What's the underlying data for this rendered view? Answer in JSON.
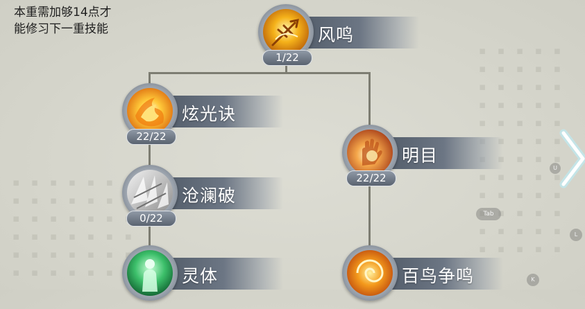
{
  "info": {
    "line1": "本重需加够14点才",
    "line2": "能修习下一重技能"
  },
  "skills": {
    "fengming": {
      "name": "风鸣",
      "count": "1/22",
      "icon": "golden-bird-icon"
    },
    "xuanguang": {
      "name": "炫光诀",
      "count": "22/22",
      "icon": "golden-flame-icon"
    },
    "mingmu": {
      "name": "明目",
      "count": "22/22",
      "icon": "glowing-hand-icon"
    },
    "canglan": {
      "name": "沧澜破",
      "count": "0/22",
      "icon": "crystal-shards-icon"
    },
    "lingti": {
      "name": "灵体",
      "icon": "spirit-body-icon"
    },
    "bainiao": {
      "name": "百鸟争鸣",
      "icon": "phoenix-swirl-icon"
    }
  },
  "hints": {
    "u": "U",
    "tab": "Tab",
    "l": "L",
    "k": "K"
  },
  "colors": {
    "background": "#d6d6cc",
    "label_bar": "#5d6775",
    "connector": "#7d7d72",
    "arrow": "#8ee8ff"
  }
}
